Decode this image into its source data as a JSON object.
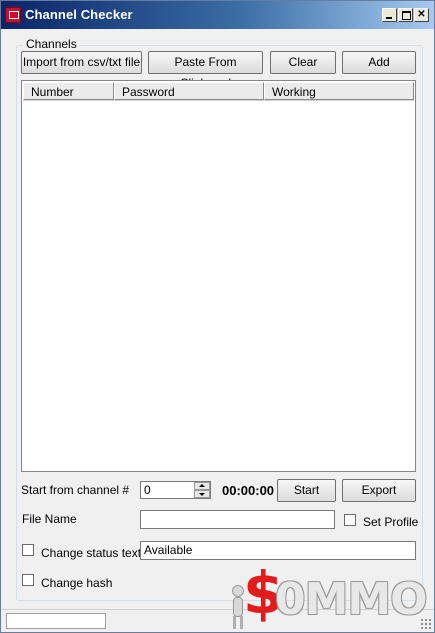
{
  "window": {
    "title": "Channel Checker",
    "controls": [
      "minimize",
      "maximize",
      "close"
    ]
  },
  "channels_group": {
    "legend": "Channels",
    "buttons": {
      "import": "Import from csv/txt file",
      "paste": "Paste From Clipboard",
      "clear": "Clear",
      "add": "Add"
    },
    "list": {
      "columns": [
        "Number",
        "Password",
        "Working"
      ],
      "rows": []
    },
    "start_from_label": "Start from channel #",
    "start_from_value": "0",
    "timer": "00:00:00",
    "start_button": "Start",
    "export_button": "Export",
    "file_name_label": "File Name",
    "file_name_value": "",
    "set_profile_label": "Set Profile",
    "set_profile_checked": false,
    "change_status_label": "Change status text",
    "change_status_checked": false,
    "status_text_value": "Available",
    "change_hash_label": "Change hash",
    "change_hash_checked": false
  },
  "watermark": {
    "text": "$0MMO"
  },
  "colors": {
    "titlebar_start": "#0a246a",
    "titlebar_end": "#a6caf0",
    "watermark_red": "#e41b1b"
  }
}
